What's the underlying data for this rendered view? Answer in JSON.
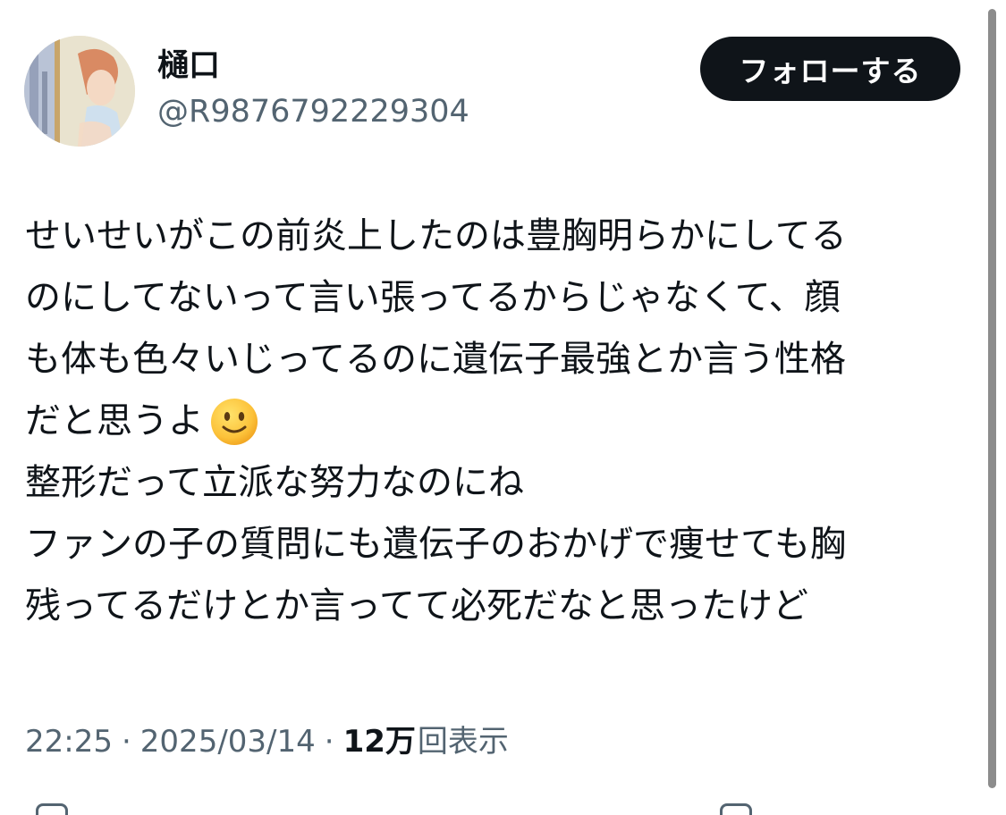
{
  "author": {
    "display_name": "樋口",
    "handle": "@R9876792229304",
    "avatar_icon": "anime-character-avatar"
  },
  "follow_button": {
    "label": "フォローする"
  },
  "tweet": {
    "lines": [
      "せいせいがこの前炎上したのは豊胸明らかにしてる",
      "のにしてないって言い張ってるからじゃなくて、顔",
      "も体も色々いじってるのに遺伝子最強とか言う性格",
      "だと思うよ",
      "整形だって立派な努力なのにね",
      "ファンの子の質問にも遺伝子のおかげで痩せても胸",
      "残ってるだけとか言ってて必死だなと思ったけど"
    ],
    "emoji": "slightly-smiling-face-icon"
  },
  "meta": {
    "time": "22:25",
    "separator": "·",
    "date": "2025/03/14",
    "views_count": "12万",
    "views_label": "回表示"
  },
  "colors": {
    "text": "#0f1419",
    "secondary": "#536471",
    "button_bg": "#0f1419",
    "button_text": "#ffffff"
  }
}
